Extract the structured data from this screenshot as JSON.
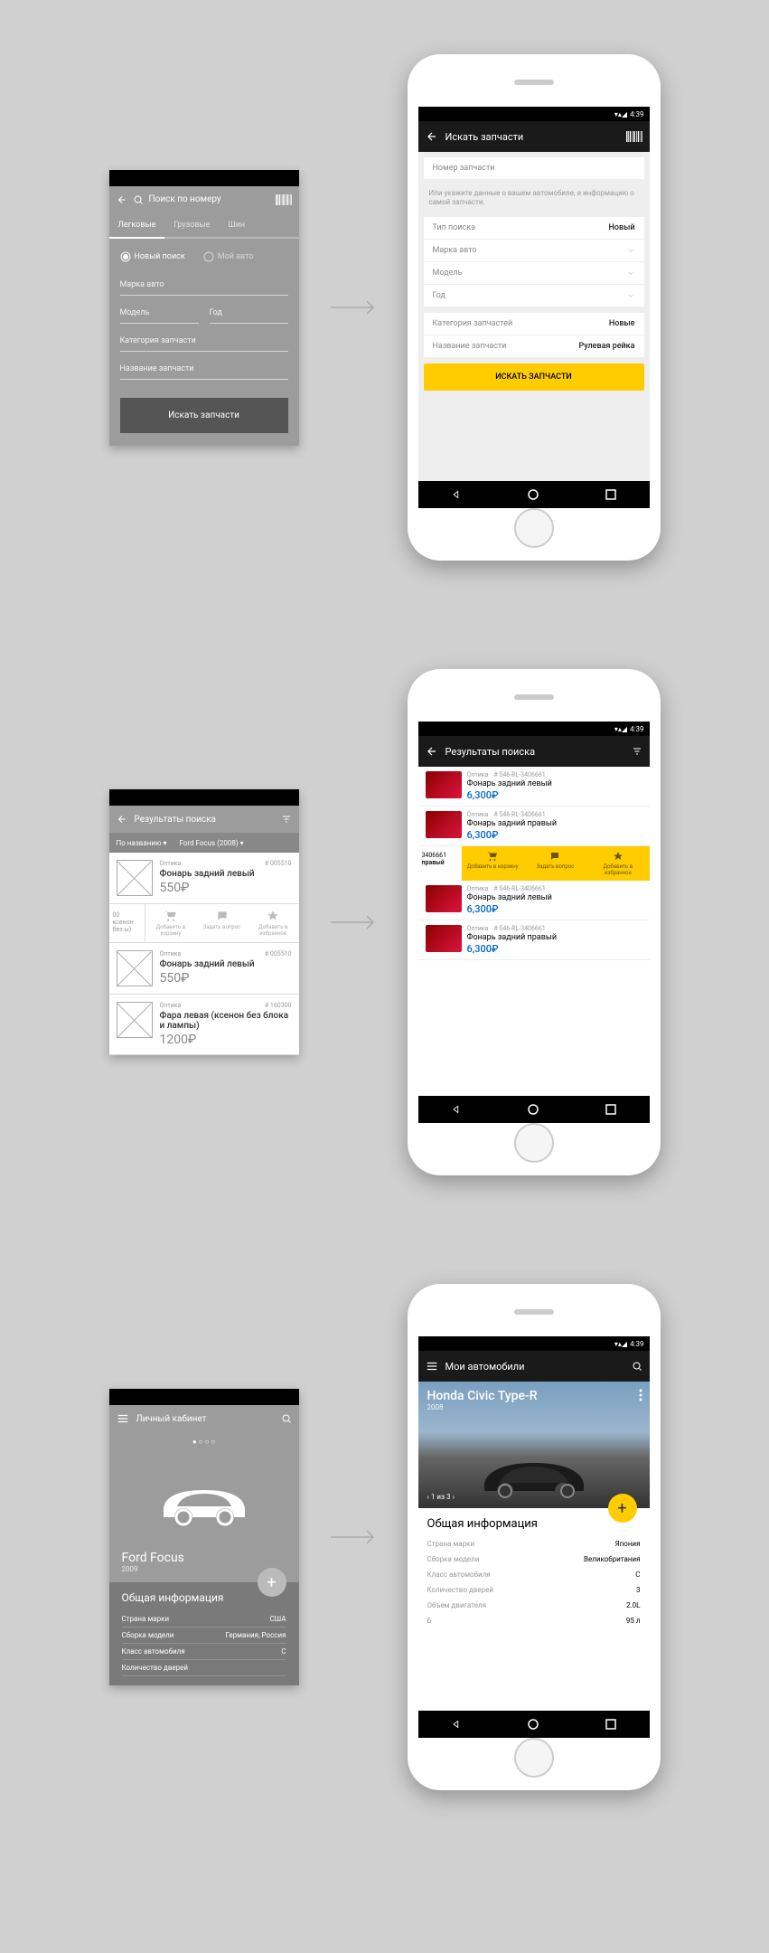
{
  "status_time": "4:39",
  "wire1": {
    "search_placeholder": "Поиск по номеру",
    "tabs": [
      "Легковые",
      "Грузовые",
      "Шин"
    ],
    "radio_new": "Новый поиск",
    "radio_my": "Мой авто",
    "fields": {
      "brand": "Марка авто",
      "model": "Модель",
      "year": "Год",
      "category": "Категория запчасти",
      "name": "Название запчасти"
    },
    "button": "Искать запчасти"
  },
  "phone1": {
    "title": "Искать запчасти",
    "part_number_placeholder": "Номер запчасти",
    "hint": "Или укажите данные о вашем автомобиле, и информацию о самой запчасти.",
    "rows": {
      "search_type_l": "Тип поиска",
      "search_type_v": "Новый",
      "brand_l": "Марка авто",
      "brand_v": "",
      "model_l": "Модель",
      "model_v": "",
      "year_l": "Год",
      "year_v": "",
      "cat_l": "Категория запчастей",
      "cat_v": "Новые",
      "name_l": "Название запчасти",
      "name_v": "Рулевая рейка"
    },
    "button": "ИСКАТЬ ЗАПЧАСТИ"
  },
  "wire2": {
    "title": "Результаты поиска",
    "sort": "По названию ▾",
    "filter": "Ford Focus (2008) ▾",
    "items": [
      {
        "cat": "Оптика",
        "num": "# 005510",
        "name": "Фонарь задний левый",
        "price": "550₽"
      },
      {
        "cat": "Оптика",
        "num": "# 005510",
        "name": "Фонарь задний левый",
        "price": "550₽"
      },
      {
        "cat": "Оптика",
        "num": "# 160300",
        "name": "Фара левая (ксенон без блока и лампы)",
        "price": "1200₽"
      }
    ],
    "action_cut_num": "00",
    "action_cut_name": "ксенон без ы)",
    "act_cart": "Добавить в корзину",
    "act_ask": "Задать вопрос",
    "act_fav": "Добавить в избранное"
  },
  "phone2": {
    "title": "Результаты поиска",
    "items": [
      {
        "cat": "Оптика",
        "num": "# 546-RL-3406661",
        "name": "Фонарь задний левый",
        "price": "6,300₽"
      },
      {
        "cat": "Оптика",
        "num": "# 546-RL-3406661",
        "name": "Фонарь задний правый",
        "price": "6,300₽"
      },
      {
        "cat": "Оптика",
        "num": "# 546-RL-3406661",
        "name": "Фонарь задний левый",
        "price": "6,300₽"
      },
      {
        "cat": "Оптика",
        "num": "# 546-RL-3406661",
        "name": "Фонарь задний правый",
        "price": "6,300₽"
      }
    ],
    "action_cut_num": "3406661",
    "action_cut_name": "правый",
    "act_cart": "Добавить в корзину",
    "act_ask": "Задать вопрос",
    "act_fav": "Добавить в избранное"
  },
  "wire3": {
    "title": "Личный кабинет",
    "car_name": "Ford Focus",
    "car_year": "2009",
    "section": "Общая информация",
    "rows": [
      {
        "l": "Страна марки",
        "v": "США"
      },
      {
        "l": "Сборка модели",
        "v": "Германия, Россия"
      },
      {
        "l": "Класс автомобиля",
        "v": "C"
      },
      {
        "l": "Количество дверей",
        "v": ""
      }
    ]
  },
  "phone3": {
    "title": "Мои автомобили",
    "car_name": "Honda Civic Type-R",
    "car_year": "2008",
    "pagination": "1 из 3",
    "section": "Общая информация",
    "rows": [
      {
        "l": "Страна марки",
        "v": "Япония"
      },
      {
        "l": "Сборка модели",
        "v": "Великобритания"
      },
      {
        "l": "Класс автомобиля",
        "v": "C"
      },
      {
        "l": "Количество дверей",
        "v": "3"
      },
      {
        "l": "Объем двигателя",
        "v": "2.0L"
      },
      {
        "l": "Б",
        "v": "95 л"
      }
    ]
  }
}
